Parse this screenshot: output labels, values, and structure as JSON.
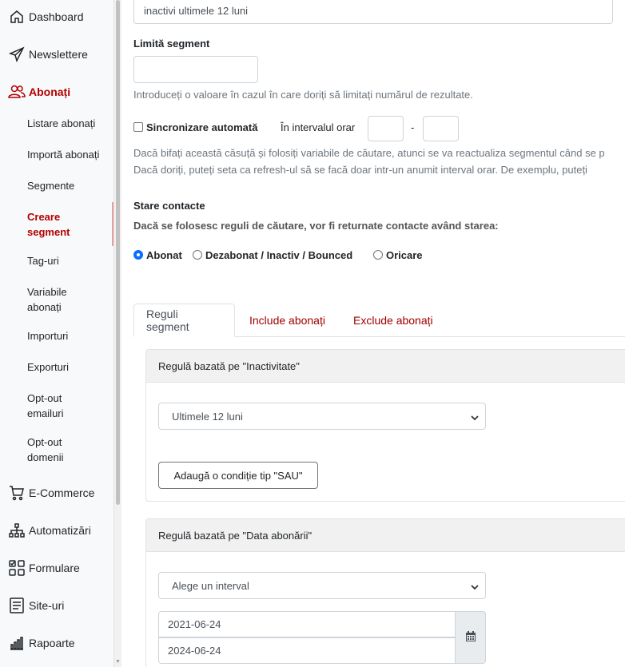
{
  "sidebar": {
    "items": [
      {
        "label": "Dashboard",
        "icon": "home-icon"
      },
      {
        "label": "Newslettere",
        "icon": "send-icon"
      },
      {
        "label": "Abonați",
        "icon": "users-icon"
      },
      {
        "label": "E-Commerce",
        "icon": "cart-icon"
      },
      {
        "label": "Automatizări",
        "icon": "sitemap-icon"
      },
      {
        "label": "Formulare",
        "icon": "form-icon"
      },
      {
        "label": "Site-uri",
        "icon": "site-icon"
      },
      {
        "label": "Rapoarte",
        "icon": "chart-icon"
      }
    ],
    "subitems": [
      {
        "label": "Listare abonați"
      },
      {
        "label": "Importă abonați"
      },
      {
        "label": "Segmente"
      },
      {
        "label": "Creare segment"
      },
      {
        "label": "Tag-uri"
      },
      {
        "label": "Variabile abonați"
      },
      {
        "label": "Importuri"
      },
      {
        "label": "Exporturi"
      },
      {
        "label": "Opt-out emailuri"
      },
      {
        "label": "Opt-out domenii"
      }
    ],
    "accent": "#b30000"
  },
  "form": {
    "description_value": "inactivi ultimele 12 luni",
    "limit_label": "Limită segment",
    "limit_value": "",
    "limit_help": "Introduceți o valoare în cazul în care doriți să limitați numărul de rezultate.",
    "sync_label": "Sincronizare automată",
    "interval_label": "În intervalul orar",
    "interval_from": "",
    "interval_sep": "-",
    "interval_to": "",
    "sync_help_1": "Dacă bifați această căsuță și folosiți variabile de căutare, atunci se va reactualiza segmentul când se p",
    "sync_help_2": "Dacă doriți, puteți seta ca refresh-ul să se facă doar intr-un anumit interval orar. De exemplu, puteți",
    "status_title": "Stare contacte",
    "status_subtitle": "Dacă se folosesc reguli de căutare, vor fi returnate contacte având starea:",
    "status_options": [
      {
        "label": "Abonat",
        "checked": true
      },
      {
        "label": "Dezabonat / Inactiv / Bounced",
        "checked": false
      },
      {
        "label": "Oricare",
        "checked": false
      }
    ]
  },
  "tabs": [
    {
      "label": "Reguli segment",
      "active": true
    },
    {
      "label": "Include abonați",
      "active": false
    },
    {
      "label": "Exclude abonați",
      "active": false
    }
  ],
  "rules": [
    {
      "title": "Regulă bazată pe \"Inactivitate\"",
      "select_value": "Ultimele 12 luni",
      "button_label": "Adaugă o condiție tip \"SAU\""
    },
    {
      "title": "Regulă bazată pe \"Data abonării\"",
      "select_value": "Alege un interval",
      "date_from": "2021-06-24",
      "date_to": "2024-06-24"
    }
  ]
}
